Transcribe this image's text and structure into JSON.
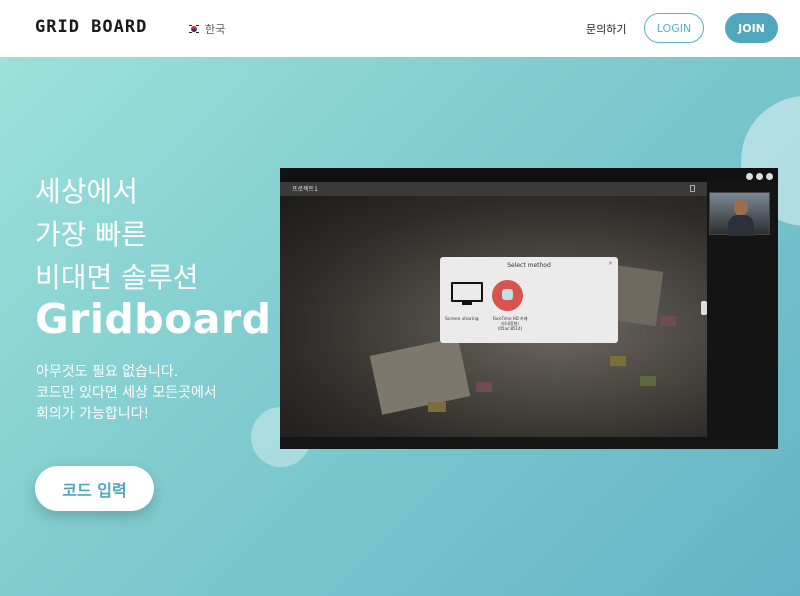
{
  "header": {
    "logo": "GRID BOARD",
    "language": "한국",
    "contact_label": "문의하기",
    "login_label": "LOGIN",
    "join_label": "JOIN"
  },
  "hero": {
    "headline_lines": [
      "세상에서",
      "가장 빠른",
      "비대면 솔루션"
    ],
    "brand": "Gridboard",
    "description_lines": [
      "아무것도 필요 없습니다.",
      "코드만 있다면 세상 모든곳에서",
      "회의가 가능합니다!"
    ],
    "code_button_label": "코드 입력"
  },
  "mockup": {
    "project_title": "프로젝트1",
    "modal_title": "Select method",
    "modal_close": "×",
    "option_screen_label": "Screen sharing",
    "option_face_label_1": "FaceTime HD 카메",
    "option_face_label_2": "라(내장형)",
    "option_face_label_3": "(05ac:8514)"
  },
  "colors": {
    "accent": "#4fa6bd",
    "hero_start": "#9de1d9",
    "hero_end": "#63b4c5"
  }
}
